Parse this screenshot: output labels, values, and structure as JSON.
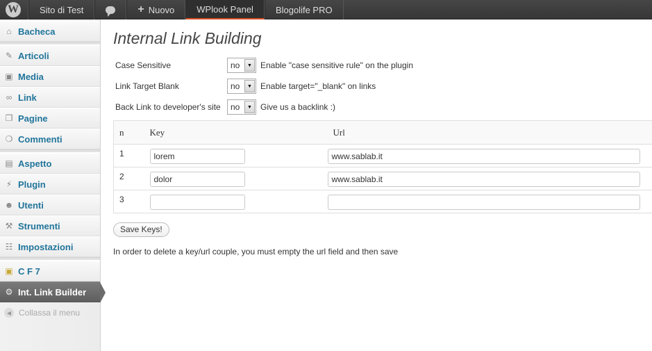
{
  "adminbar": {
    "logo": "W",
    "items": [
      "Sito di Test",
      "Nuovo",
      "WPlook Panel",
      "Blogolife PRO"
    ],
    "comments_icon": "comment-bubble-icon"
  },
  "sidebar": {
    "group1": [
      {
        "label": "Bacheca",
        "icon": "dashboard-icon"
      }
    ],
    "group2": [
      {
        "label": "Articoli",
        "icon": "pin-icon"
      },
      {
        "label": "Media",
        "icon": "media-icon"
      },
      {
        "label": "Link",
        "icon": "link-icon"
      },
      {
        "label": "Pagine",
        "icon": "pages-icon"
      },
      {
        "label": "Commenti",
        "icon": "comments-icon"
      }
    ],
    "group3": [
      {
        "label": "Aspetto",
        "icon": "appearance-icon"
      },
      {
        "label": "Plugin",
        "icon": "plugin-icon"
      },
      {
        "label": "Utenti",
        "icon": "users-icon"
      },
      {
        "label": "Strumenti",
        "icon": "tools-icon"
      },
      {
        "label": "Impostazioni",
        "icon": "settings-icon"
      }
    ],
    "group4": [
      {
        "label": "C F 7",
        "icon": "cf7-icon"
      },
      {
        "label": "Int. Link Builder",
        "icon": "gear-icon"
      }
    ],
    "collapse_label": "Collassa il menu"
  },
  "main": {
    "title": "Internal Link Building",
    "options": [
      {
        "label": "Case Sensitive",
        "value": "no",
        "desc": "Enable \"case sensitive rule\" on the plugin"
      },
      {
        "label": "Link Target Blank",
        "value": "no",
        "desc": "Enable target=\"_blank\" on links"
      },
      {
        "label": "Back Link to developer's site",
        "value": "no",
        "desc": "Give us a backlink :)"
      }
    ],
    "table": {
      "headers": [
        "n",
        "Key",
        "Url"
      ],
      "rows": [
        {
          "n": "1",
          "key": "lorem",
          "url": "www.sablab.it"
        },
        {
          "n": "2",
          "key": "dolor",
          "url": "www.sablab.it"
        },
        {
          "n": "3",
          "key": "",
          "url": ""
        }
      ]
    },
    "save_label": "Save Keys!",
    "note": "In order to delete a key/url couple, you must empty the url field and then save"
  }
}
